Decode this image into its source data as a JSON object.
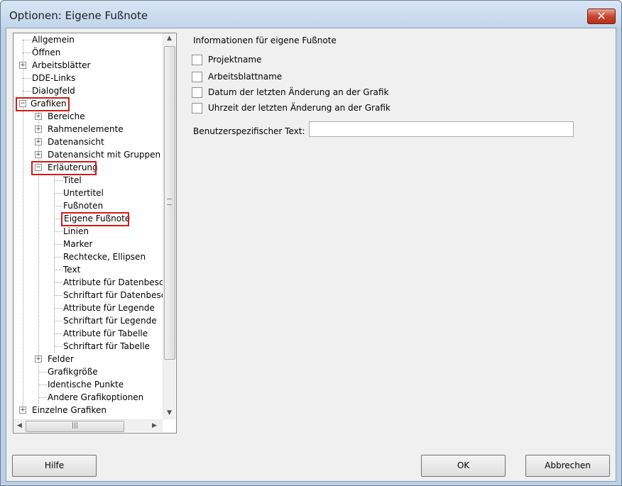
{
  "window": {
    "title": "Optionen: Eigene Fußnote",
    "close_symbol": "✕"
  },
  "tree": {
    "items": [
      {
        "label": "Allgemein",
        "expander": ""
      },
      {
        "label": "Öffnen",
        "expander": ""
      },
      {
        "label": "Arbeitsblätter",
        "expander": "+"
      },
      {
        "label": "DDE-Links",
        "expander": ""
      },
      {
        "label": "Dialogfeld",
        "expander": ""
      },
      {
        "label": "Grafiken",
        "expander": "−"
      },
      {
        "label": "Bereiche",
        "expander": "+"
      },
      {
        "label": "Rahmenelemente",
        "expander": "+"
      },
      {
        "label": "Datenansicht",
        "expander": "+"
      },
      {
        "label": "Datenansicht mit Gruppen",
        "expander": "+"
      },
      {
        "label": "Erläuterung",
        "expander": "−"
      },
      {
        "label": "Titel",
        "expander": ""
      },
      {
        "label": "Untertitel",
        "expander": ""
      },
      {
        "label": "Fußnoten",
        "expander": ""
      },
      {
        "label": "Eigene Fußnote",
        "expander": ""
      },
      {
        "label": "Linien",
        "expander": ""
      },
      {
        "label": "Marker",
        "expander": ""
      },
      {
        "label": "Rechtecke, Ellipsen",
        "expander": ""
      },
      {
        "label": "Text",
        "expander": ""
      },
      {
        "label": "Attribute für Datenbeschriftungen",
        "expander": ""
      },
      {
        "label": "Schriftart für Datenbeschriftungen",
        "expander": ""
      },
      {
        "label": "Attribute für Legende",
        "expander": ""
      },
      {
        "label": "Schriftart für Legende",
        "expander": ""
      },
      {
        "label": "Attribute für Tabelle",
        "expander": ""
      },
      {
        "label": "Schriftart für Tabelle",
        "expander": ""
      },
      {
        "label": "Felder",
        "expander": "+"
      },
      {
        "label": "Grafikgröße",
        "expander": ""
      },
      {
        "label": "Identische Punkte",
        "expander": ""
      },
      {
        "label": "Andere Grafikoptionen",
        "expander": ""
      },
      {
        "label": "Einzelne Grafiken",
        "expander": "+"
      }
    ],
    "selected": "Eigene Fußnote",
    "highlighted": [
      "Grafiken",
      "Erläuterung",
      "Eigene Fußnote"
    ],
    "highlight_color": "#d01a1a"
  },
  "panel": {
    "section_title": "Informationen für eigene Fußnote",
    "checkboxes": [
      {
        "label": "Projektname",
        "checked": false
      },
      {
        "label": "Arbeitsblattname",
        "checked": false
      },
      {
        "label": "Datum der letzten Änderung an der Grafik",
        "checked": false
      },
      {
        "label": "Uhrzeit der letzten Änderung an der Grafik",
        "checked": false
      }
    ],
    "custom_text_label": "Benutzerspezifischer Text:",
    "custom_text_value": ""
  },
  "buttons": {
    "help": "Hilfe",
    "ok": "OK",
    "cancel": "Abbrechen"
  }
}
